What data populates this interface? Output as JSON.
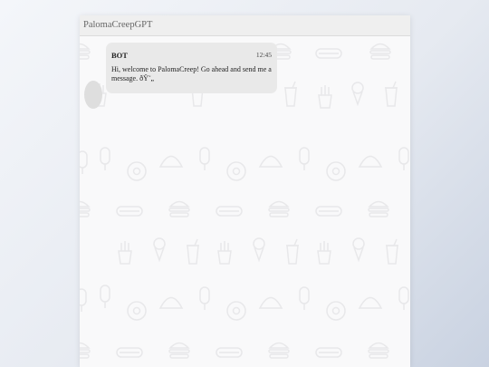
{
  "window": {
    "title": "PalomaCreepGPT"
  },
  "messages": [
    {
      "sender": "BOT",
      "time": "12:45",
      "text": "Hi, welcome to PalomaCreep! Go ahead and send me a message. ðŸ˜„"
    }
  ],
  "colors": {
    "bubble": "#e9e9e9",
    "chat_background": "#f9f9fa",
    "pattern": "#ececee"
  }
}
